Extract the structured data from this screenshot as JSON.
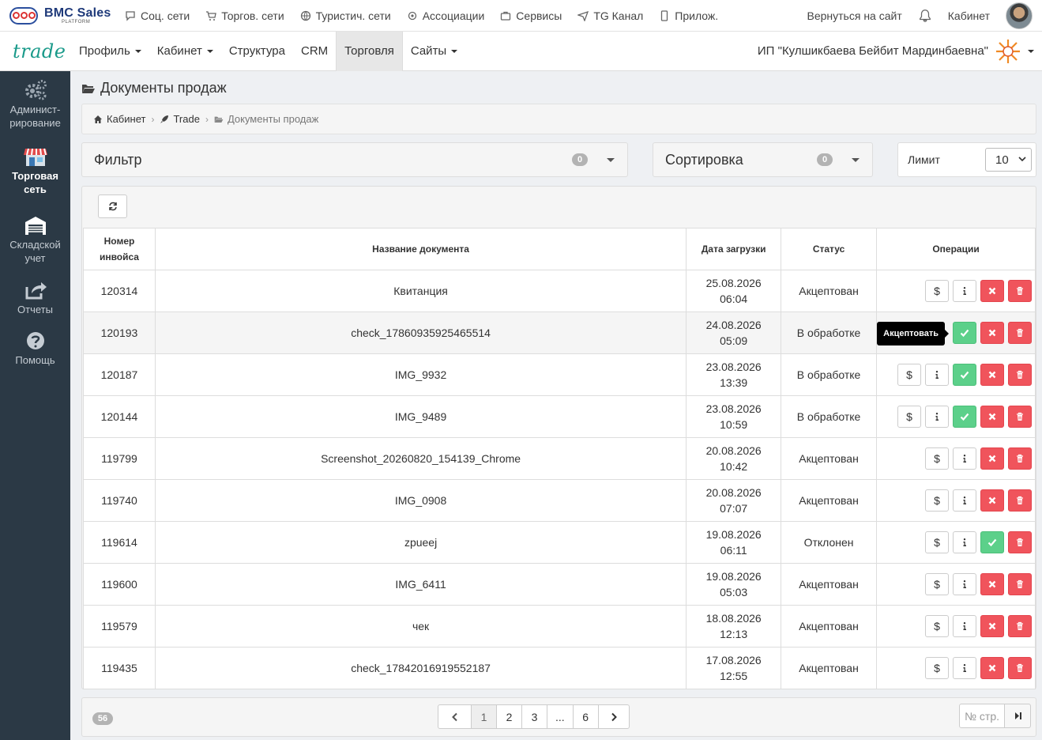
{
  "topbar": {
    "brand": "BMC Sales",
    "brand_sub": "PLATFORM",
    "nav": [
      {
        "label": "Соц. сети",
        "icon": "chat-icon"
      },
      {
        "label": "Торгов. сети",
        "icon": "cart-icon"
      },
      {
        "label": "Туристич. сети",
        "icon": "globe-icon"
      },
      {
        "label": "Ассоциации",
        "icon": "gear-icon"
      },
      {
        "label": "Сервисы",
        "icon": "briefcase-icon"
      },
      {
        "label": "TG Канал",
        "icon": "paper-plane-icon"
      },
      {
        "label": "Прилож.",
        "icon": "mobile-icon"
      }
    ],
    "return_link": "Вернуться на сайт",
    "cabinet": "Кабинет"
  },
  "navbar": {
    "logo": "trade",
    "menu": [
      {
        "label": "Профиль",
        "dropdown": true
      },
      {
        "label": "Кабинет",
        "dropdown": true
      },
      {
        "label": "Структура",
        "dropdown": false
      },
      {
        "label": "CRM",
        "dropdown": false
      },
      {
        "label": "Торговля",
        "dropdown": false,
        "active": true
      },
      {
        "label": "Сайты",
        "dropdown": true
      }
    ],
    "company": "ИП \"Кулшикбаева Бейбит Мардинбаевна\""
  },
  "sidebar": {
    "items": [
      {
        "label1": "Админист-",
        "label2": "рирование",
        "icon": "gears-icon"
      },
      {
        "label1": "Торговая",
        "label2": "сеть",
        "icon": "store-icon",
        "active": true
      },
      {
        "label1": "Складской",
        "label2": "учет",
        "icon": "warehouse-icon"
      },
      {
        "label1": "Отчеты",
        "label2": "",
        "icon": "share-icon"
      },
      {
        "label1": "Помощь",
        "label2": "",
        "icon": "question-icon"
      }
    ]
  },
  "page": {
    "title": "Документы продаж",
    "breadcrumb": [
      "Кабинет",
      "Trade",
      "Документы продаж"
    ],
    "filter_label": "Фильтр",
    "filter_count": "0",
    "sort_label": "Сортировка",
    "sort_count": "0",
    "limit_label": "Лимит",
    "limit_value": "10"
  },
  "table": {
    "headers": [
      "Номер инвойса",
      "Название документа",
      "Дата загрузки",
      "Статус",
      "Операции"
    ],
    "rows": [
      {
        "invoice": "120314",
        "name": "Квитанция",
        "date": "25.08.2026",
        "time": "06:04",
        "status": "Акцептован",
        "ops": [
          "dollar",
          "info",
          "reject",
          "delete"
        ]
      },
      {
        "invoice": "120193",
        "name": "check_17860935925465514",
        "date": "24.08.2026",
        "time": "05:09",
        "status": "В обработке",
        "ops": [
          "accept",
          "reject",
          "delete"
        ],
        "tooltip": "Акцептовать",
        "highlight": true
      },
      {
        "invoice": "120187",
        "name": "IMG_9932",
        "date": "23.08.2026",
        "time": "13:39",
        "status": "В обработке",
        "ops": [
          "dollar",
          "info",
          "accept",
          "reject",
          "delete"
        ]
      },
      {
        "invoice": "120144",
        "name": "IMG_9489",
        "date": "23.08.2026",
        "time": "10:59",
        "status": "В обработке",
        "ops": [
          "dollar",
          "info",
          "accept",
          "reject",
          "delete"
        ]
      },
      {
        "invoice": "119799",
        "name": "Screenshot_20260820_154139_Chrome",
        "date": "20.08.2026",
        "time": "10:42",
        "status": "Акцептован",
        "ops": [
          "dollar",
          "info",
          "reject",
          "delete"
        ]
      },
      {
        "invoice": "119740",
        "name": "IMG_0908",
        "date": "20.08.2026",
        "time": "07:07",
        "status": "Акцептован",
        "ops": [
          "dollar",
          "info",
          "reject",
          "delete"
        ]
      },
      {
        "invoice": "119614",
        "name": "zpueej",
        "date": "19.08.2026",
        "time": "06:11",
        "status": "Отклонен",
        "ops": [
          "dollar",
          "info",
          "accept",
          "delete"
        ]
      },
      {
        "invoice": "119600",
        "name": "IMG_6411",
        "date": "19.08.2026",
        "time": "05:03",
        "status": "Акцептован",
        "ops": [
          "dollar",
          "info",
          "reject",
          "delete"
        ]
      },
      {
        "invoice": "119579",
        "name": "чек",
        "date": "18.08.2026",
        "time": "12:13",
        "status": "Акцептован",
        "ops": [
          "dollar",
          "info",
          "reject",
          "delete"
        ]
      },
      {
        "invoice": "119435",
        "name": "check_17842016919552187",
        "date": "17.08.2026",
        "time": "12:55",
        "status": "Акцептован",
        "ops": [
          "dollar",
          "info",
          "reject",
          "delete"
        ]
      }
    ]
  },
  "pagination": {
    "total": "56",
    "pages": [
      "1",
      "2",
      "3",
      "...",
      "6"
    ],
    "current": "1",
    "page_input_placeholder": "№ стр."
  },
  "colors": {
    "sidebar": "#2b3945",
    "accept": "#5cd08a",
    "danger": "#f0545c",
    "logo": "#1a9a8a"
  }
}
